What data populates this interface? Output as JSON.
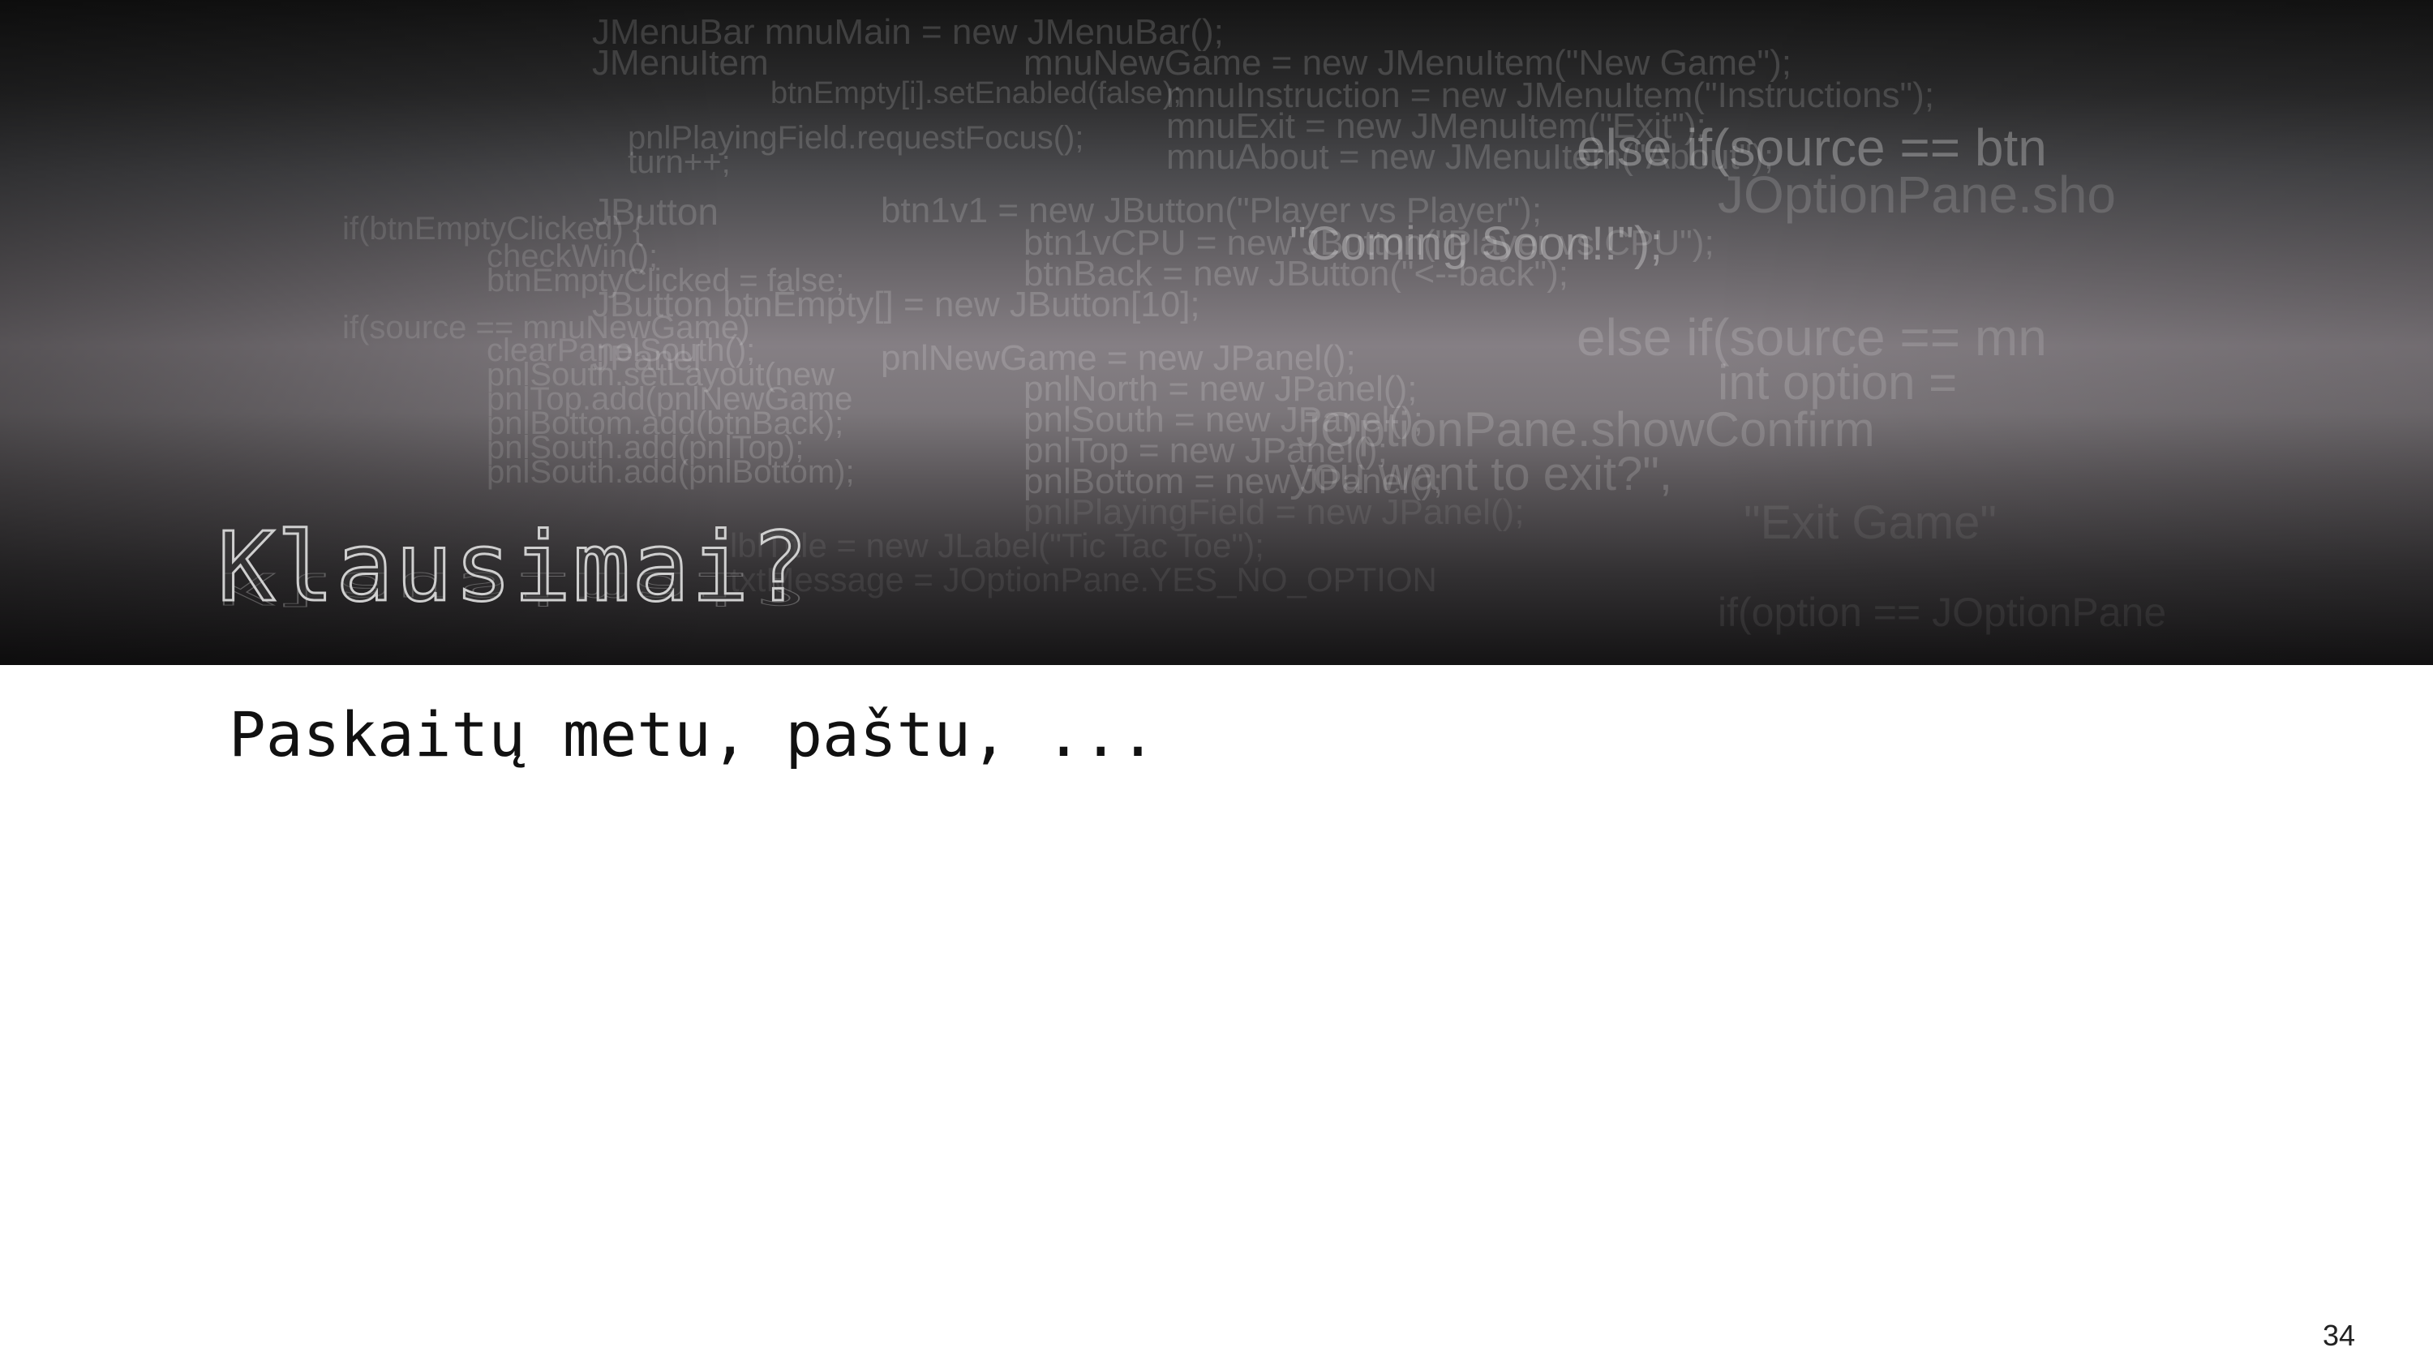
{
  "slide": {
    "title": "Klausimai?",
    "body": "Paskaitų metu, paštu, ...",
    "page_number": "34"
  },
  "background_code": [
    "JMenuBar mnuMain = new JMenuBar();",
    "JMenuItem",
    "mnuNewGame = new JMenuItem(\"New Game\");",
    "mnuInstruction = new JMenuItem(\"Instructions\");",
    "mnuExit = new JMenuItem(\"Exit\");",
    "mnuAbout = new JMenuItem(\"About\");",
    "else if(source == btn",
    "JOptionPane.sho",
    "\"Coming Soon!!\");",
    "JButton",
    "btn1v1 = new JButton(\"Player vs Player\");",
    "btn1vCPU = new JButton(\"Player vs CPU\");",
    "btnBack = new JButton(\"<--back\");",
    "JButton btnEmpty[] = new JButton[10];",
    "else if(source == mn",
    "JPanel",
    "pnlNewGame = new JPanel();",
    "pnlNorth = new JPanel();",
    "int option =",
    "pnlSouth = new JPanel();",
    "JOptionPane.showConfirm",
    "pnlTop = new JPanel();",
    "you want to exit?\",",
    "pnlBottom = new JPanel();",
    "pnlPlayingField = new JPanel();",
    "\"Exit Game\"",
    "btnEmpty[i].setEnabled(false);",
    "pnlPlayingField.requestFocus();",
    "turn++;",
    "if(btnEmptyClicked) {",
    "checkWin();",
    "btnEmptyClicked = false;",
    "if(source == mnuNewGame)",
    "clearPanelSouth();",
    "pnlSouth.setLayout(new",
    "pnlTop.add(pnlNewGame",
    "pnlBottom.add(btnBack);",
    "pnlSouth.add(pnlTop);",
    "pnlSouth.add(pnlBottom);",
    "lblTitle = new JLabel(\"Tic Tac Toe\");",
    "txtMessage = JOptionPane.YES_NO_OPTION",
    "if(option == JOptionPane"
  ]
}
